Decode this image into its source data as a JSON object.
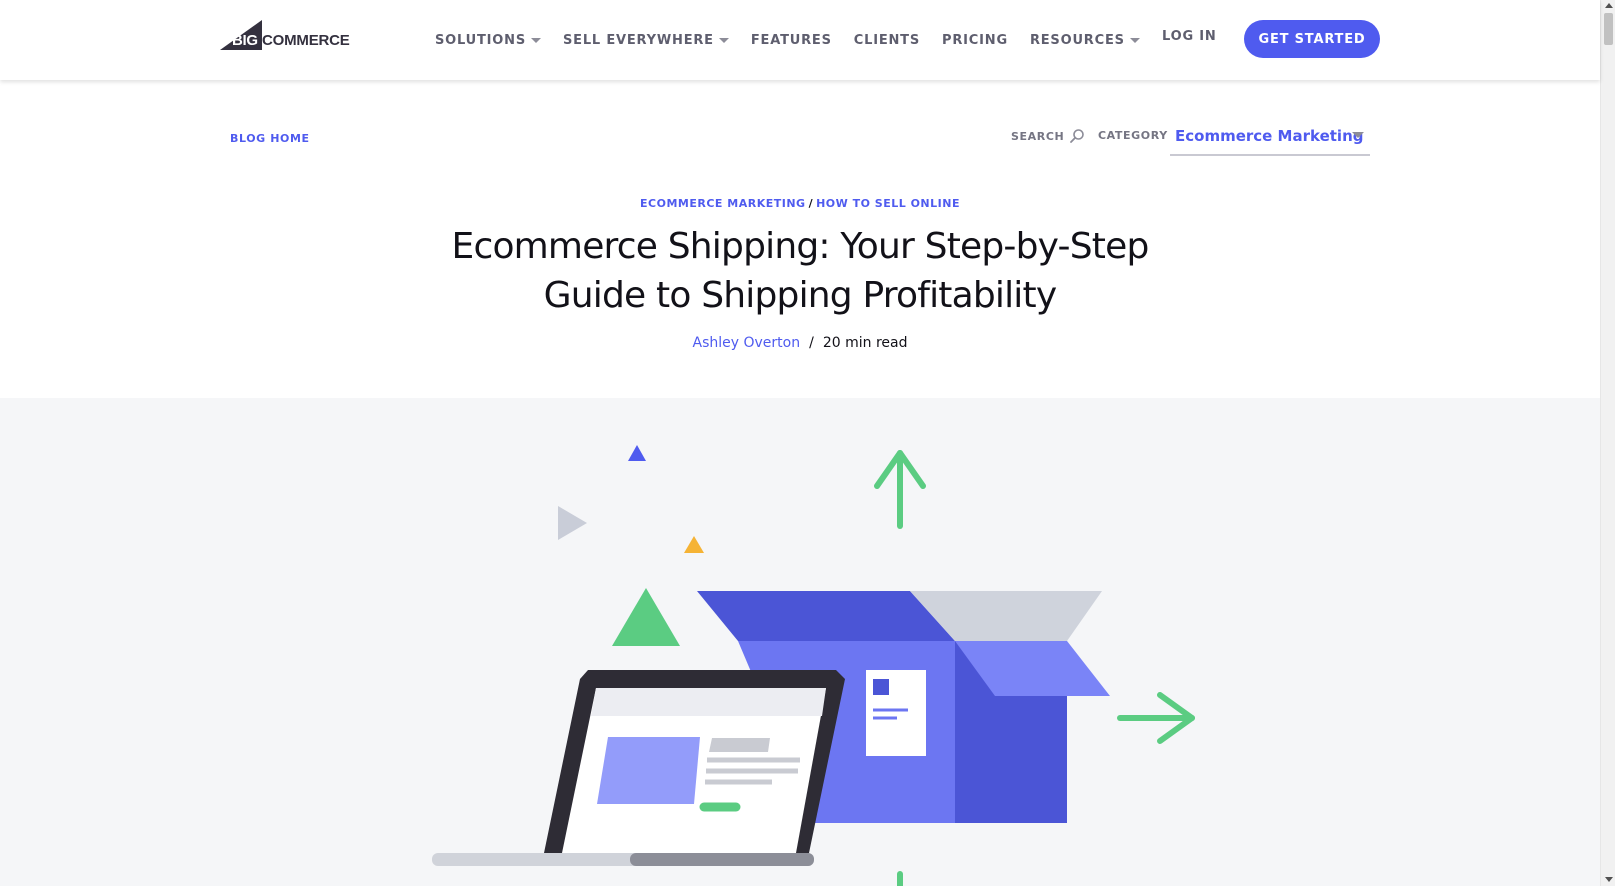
{
  "header": {
    "logo_big": "BIG",
    "logo_commerce": "COMMERCE",
    "nav": [
      {
        "label": "SOLUTIONS",
        "has_dropdown": true
      },
      {
        "label": "SELL EVERYWHERE",
        "has_dropdown": true
      },
      {
        "label": "FEATURES",
        "has_dropdown": false
      },
      {
        "label": "CLIENTS",
        "has_dropdown": false
      },
      {
        "label": "PRICING",
        "has_dropdown": false
      },
      {
        "label": "RESOURCES",
        "has_dropdown": true
      }
    ],
    "login_label": "LOG IN",
    "cta_label": "GET STARTED"
  },
  "subnav": {
    "blog_home": "BLOG HOME",
    "search_label": "SEARCH",
    "category_label": "CATEGORY",
    "category_value": "Ecommerce Marketing"
  },
  "article": {
    "categories": [
      "ECOMMERCE MARKETING",
      "HOW TO SELL ONLINE"
    ],
    "category_separator": "/",
    "title_line1": "Ecommerce Shipping: Your Step-by-Step",
    "title_line2": "Guide to Shipping Profitability",
    "author": "Ashley Overton",
    "byline_separator": "/",
    "read_time": "20 min read"
  },
  "colors": {
    "brand": "#4f5bef",
    "green": "#5bcc82",
    "box_dark": "#4b55d6",
    "box_light": "#6c76f2",
    "hero_bg": "#f5f6f8"
  },
  "icons": {
    "search": "search-icon",
    "dropdown": "chevron-down-icon"
  }
}
